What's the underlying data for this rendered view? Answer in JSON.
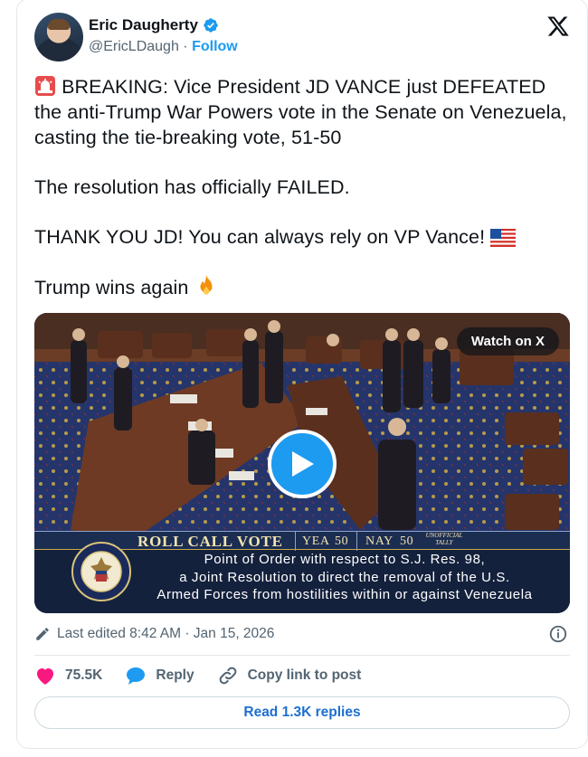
{
  "author": {
    "name": "Eric Daugherty",
    "handle": "@EricLDaugh",
    "separator": "·",
    "follow_label": "Follow"
  },
  "tweet": {
    "lines": [
      "BREAKING: Vice President JD VANCE just DEFEATED the anti-Trump War Powers vote in the Senate on Venezuela, casting the tie-breaking vote, 51-50",
      "The resolution has officially FAILED.",
      "THANK YOU JD! You can always rely on VP Vance!",
      "Trump wins again"
    ]
  },
  "media": {
    "watch_label": "Watch on X",
    "roll_call_title": "ROLL CALL VOTE",
    "yea_label": "YEA",
    "yea_value": "50",
    "nay_label": "NAY",
    "nay_value": "50",
    "unofficial_label": "UNOFFICIAL TALLY",
    "description_lines": [
      "Point of Order with respect to S.J. Res. 98,",
      "a Joint Resolution to direct the removal of the U.S.",
      "Armed Forces from hostilities within or against Venezuela"
    ]
  },
  "meta": {
    "edited_text": "Last edited 8:42 AM · Jan 15, 2026"
  },
  "actions": {
    "like_count": "75.5K",
    "reply_label": "Reply",
    "copy_link_label": "Copy link to post"
  },
  "read_replies_label": "Read 1.3K replies",
  "colors": {
    "accent": "#1d9bf0",
    "like": "#f91880",
    "text": "#0f1419",
    "secondary": "#536471"
  },
  "icons": [
    "verified-badge-icon",
    "x-logo-icon",
    "siren-emoji-icon",
    "us-flag-emoji-icon",
    "fire-emoji-icon",
    "play-icon",
    "pencil-icon",
    "info-icon",
    "heart-icon",
    "reply-bubble-icon",
    "link-icon",
    "senate-seal-icon"
  ]
}
